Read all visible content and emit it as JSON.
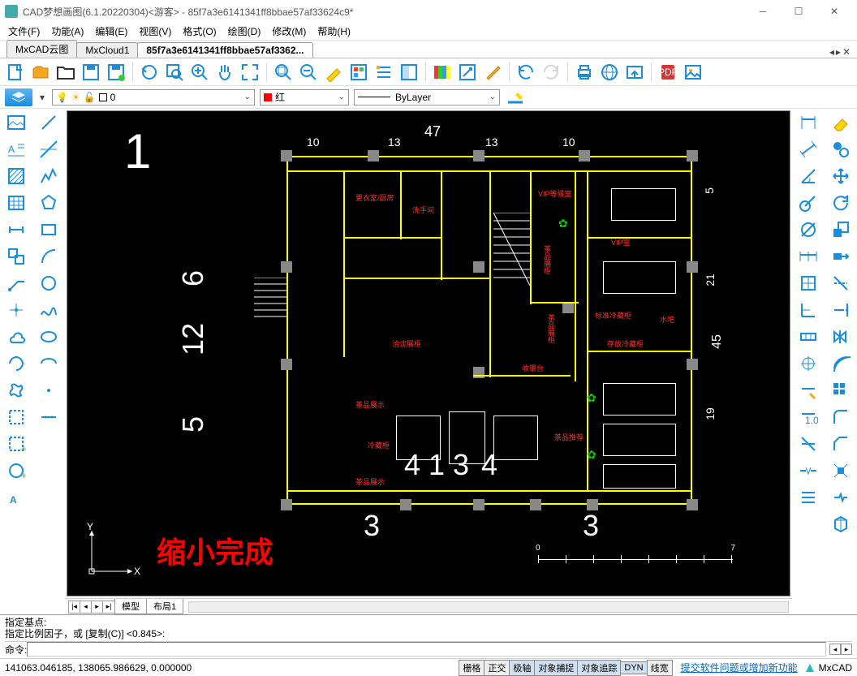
{
  "titlebar": {
    "app": "CAD梦想画图(6.1.20220304)<游客>",
    "doc": "85f7a3e6141341ff8bbae57af33624c9*",
    "sep": " - "
  },
  "menu": {
    "file": "文件(F)",
    "func": "功能(A)",
    "edit": "编辑(E)",
    "view": "视图(V)",
    "format": "格式(O)",
    "draw": "绘图(D)",
    "modify": "修改(M)",
    "help": "帮助(H)"
  },
  "tabs": {
    "t1": "MxCAD云图",
    "t2": "MxCloud1",
    "t3": "85f7a3e6141341ff8bbae57af3362..."
  },
  "prop": {
    "layer_value": "0",
    "color_label": "红",
    "linetype": "ByLayer"
  },
  "viewtabs": {
    "model": "模型",
    "layout1": "布局1"
  },
  "cmd": {
    "line1": "指定基点:",
    "line2": "指定比例因子，或 [复制(C)] <0.845>:",
    "prompt": "命令:"
  },
  "status": {
    "coords": "141063.046185,  138065.986629,  0.000000",
    "grid": "栅格",
    "ortho": "正交",
    "polar": "极轴",
    "osnap": "对象捕捉",
    "otrack": "对象追踪",
    "dyn": "DYN",
    "lw": "线宽",
    "link": "提交软件问题或增加新功能",
    "brand": "MxCAD"
  },
  "canvas": {
    "big1": "1",
    "dim_top_total": "47",
    "dim_top": [
      "10",
      "13",
      "13",
      "10"
    ],
    "dim_left": [
      "6",
      "12",
      "5"
    ],
    "dim_right_total": "45",
    "dim_right": [
      "5",
      "21",
      "19"
    ],
    "dim_bottom_nums": [
      "4",
      "1",
      "3",
      "4"
    ],
    "dim_bottom_big": "3",
    "dim_bottom_right": "3",
    "overlay": "缩小完成",
    "ucs": {
      "x": "X",
      "y": "Y"
    },
    "scale": {
      "start": "0",
      "end": "7"
    },
    "rooms": {
      "r1": "更衣室/厨房",
      "r2": "洗手间",
      "r3": "VIP等候室",
      "r4": "VIP室",
      "r5": "茶品展柜",
      "r6": "茶品展柜",
      "r7": "标准冷藏柜",
      "r8": "水吧",
      "r9": "存放冷藏柜",
      "r10": "收银台",
      "r11": "洽谈展柜",
      "r12": "茶品展示",
      "r13": "冷藏柜",
      "r14": "茶品展示",
      "r15": "茶品推荐"
    }
  }
}
